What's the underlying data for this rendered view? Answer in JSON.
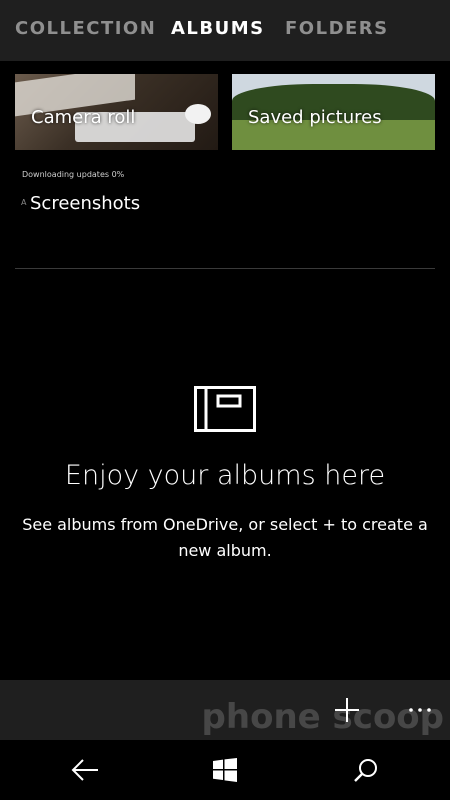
{
  "tabs": [
    {
      "label": "COLLECTION",
      "active": false
    },
    {
      "label": "ALBUMS",
      "active": true
    },
    {
      "label": "FOLDERS",
      "active": false
    }
  ],
  "albums": [
    {
      "name": "Camera roll"
    },
    {
      "name": "Saved pictures"
    },
    {
      "name": "Screenshots"
    }
  ],
  "status": {
    "text": "Downloading updates 0%",
    "ghost": "A"
  },
  "empty_state": {
    "icon": "album-book-icon",
    "title": "Enjoy your albums here",
    "description": "See albums from OneDrive, or select + to create a new album."
  },
  "app_bar": {
    "add_icon": "plus-icon",
    "add_glyph": "+",
    "more_icon": "more-icon",
    "more_glyph": "···"
  },
  "nav_bar": {
    "back_icon": "back-arrow-icon",
    "windows_icon": "windows-logo-icon",
    "search_icon": "search-icon"
  },
  "watermark": "phone scoop",
  "colors": {
    "accent": "#ffffff",
    "bar": "#1f1f1f",
    "background": "#000000"
  }
}
